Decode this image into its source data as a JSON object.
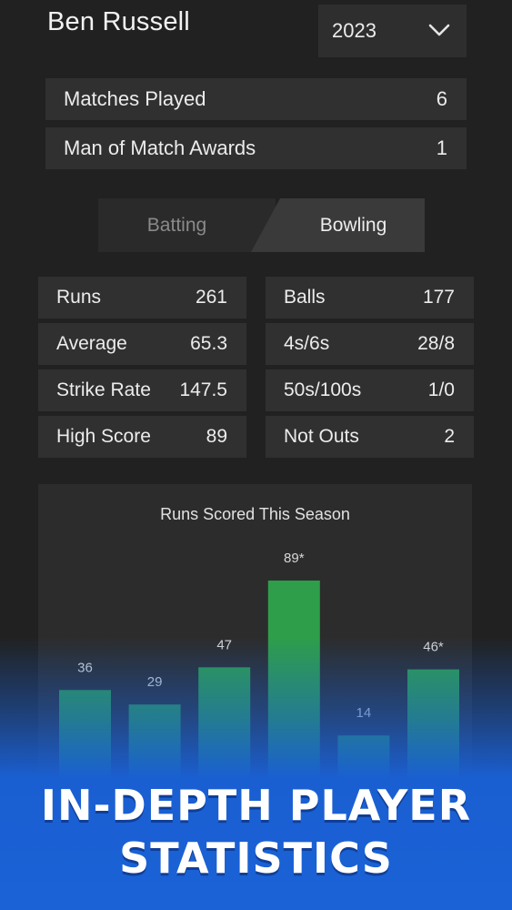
{
  "header": {
    "player_name": "Ben Russell",
    "year": "2023"
  },
  "summary": [
    {
      "label": "Matches Played",
      "value": "6"
    },
    {
      "label": "Man of Match Awards",
      "value": "1"
    }
  ],
  "tabs": {
    "batting": "Batting",
    "bowling": "Bowling",
    "active": "Bowling"
  },
  "stats_left": [
    {
      "label": "Runs",
      "value": "261"
    },
    {
      "label": "Average",
      "value": "65.3"
    },
    {
      "label": "Strike Rate",
      "value": "147.5"
    },
    {
      "label": "High Score",
      "value": "89"
    }
  ],
  "stats_right": [
    {
      "label": "Balls",
      "value": "177"
    },
    {
      "label": "4s/6s",
      "value": "28/8"
    },
    {
      "label": "50s/100s",
      "value": "1/0"
    },
    {
      "label": "Not Outs",
      "value": "2"
    }
  ],
  "chart_data": {
    "type": "bar",
    "title": "Runs Scored This Season",
    "values": [
      36,
      29,
      47,
      89,
      14,
      46
    ],
    "labels": [
      "36",
      "29",
      "47",
      "89*",
      "14",
      "46*"
    ],
    "ylim": [
      0,
      100
    ],
    "bar_color": "#2e9e4a",
    "grid": false
  },
  "promo": {
    "line1": "IN-DEPTH PLAYER",
    "line2": "STATISTICS"
  },
  "colors": {
    "background": "#212121",
    "panel": "#303030",
    "accent_blue": "#1a5fd2"
  }
}
